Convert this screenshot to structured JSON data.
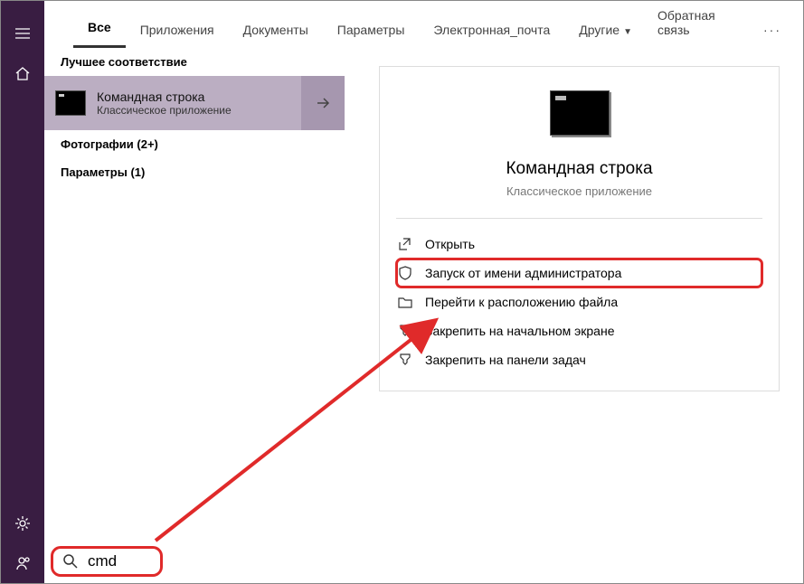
{
  "tabs": {
    "all": "Все",
    "apps": "Приложения",
    "docs": "Документы",
    "params": "Параметры",
    "email": "Электронная_почта",
    "other": "Другие"
  },
  "feedback": "Обратная связь",
  "left": {
    "best_match": "Лучшее соответствие",
    "result_title": "Командная строка",
    "result_sub": "Классическое приложение",
    "photos": "Фотографии (2+)",
    "params": "Параметры (1)"
  },
  "preview": {
    "title": "Командная строка",
    "sub": "Классическое приложение"
  },
  "actions": {
    "open": "Открыть",
    "admin": "Запуск от имени администратора",
    "location": "Перейти к расположению файла",
    "pin_start": "Закрепить на начальном экране",
    "pin_task": "Закрепить на панели задач"
  },
  "search": {
    "value": "cmd"
  }
}
